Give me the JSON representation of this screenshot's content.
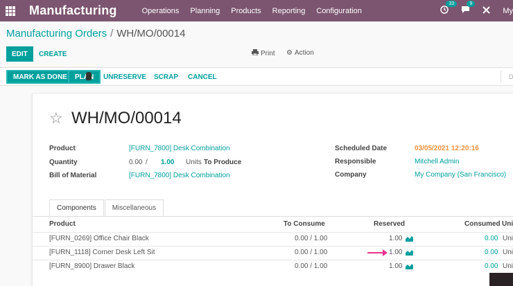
{
  "nav": {
    "brand": "Manufacturing",
    "menu": [
      "Operations",
      "Planning",
      "Products",
      "Reporting",
      "Configuration"
    ],
    "activity_count": "33",
    "messages_count": "9",
    "user": "My"
  },
  "breadcrumb": {
    "parent": "Manufacturing Orders",
    "separator": "/",
    "current": "WH/MO/00014"
  },
  "control_panel": {
    "edit": "EDIT",
    "create": "CREATE",
    "print": "Print",
    "action": "Action"
  },
  "statusbar": {
    "buttons": [
      "MARK AS DONE",
      "PLAN",
      "UNRESERVE",
      "SCRAP",
      "CANCEL"
    ],
    "right_text": "D"
  },
  "form": {
    "title": "WH/MO/00014",
    "labels": {
      "product": "Product",
      "quantity": "Quantity",
      "bom": "Bill of Material",
      "scheduled_date": "Scheduled Date",
      "responsible": "Responsible",
      "company": "Company"
    },
    "values": {
      "product": "[FURN_7800] Desk Combination",
      "qty_produced": "0.00",
      "qty_sep": "/",
      "qty_planned": "1.00",
      "uom": "Units",
      "to_produce": "To Produce",
      "bom": "[FURN_7800] Desk Combination",
      "scheduled_date": "03/05/2021 12:20:16",
      "responsible": "Mitchell Admin",
      "company": "My Company (San Francisco)"
    }
  },
  "tabs": [
    "Components",
    "Miscellaneous"
  ],
  "table": {
    "headers": {
      "product": "Product",
      "to_consume": "To Consume",
      "reserved": "Reserved",
      "consumed": "Consumed",
      "uom": "Uni"
    },
    "rows": [
      {
        "product": "[FURN_0269] Office Chair Black",
        "to_consume": "0.00 / 1.00",
        "reserved": "1.00",
        "consumed": "0.00",
        "uom": "Uni"
      },
      {
        "product": "[FURN_1118] Corner Desk Left Sit",
        "to_consume": "0.00 / 1.00",
        "reserved": "1.00",
        "consumed": "0.00",
        "uom": "Uni"
      },
      {
        "product": "[FURN_8900] Drawer Black",
        "to_consume": "0.00 / 1.00",
        "reserved": "1.00",
        "consumed": "0.00",
        "uom": "Uni"
      }
    ]
  },
  "colors": {
    "navbar": "#7c5570",
    "primary": "#00a09d",
    "date": "#f0913e",
    "annotation_arrow": "#e8328a"
  }
}
